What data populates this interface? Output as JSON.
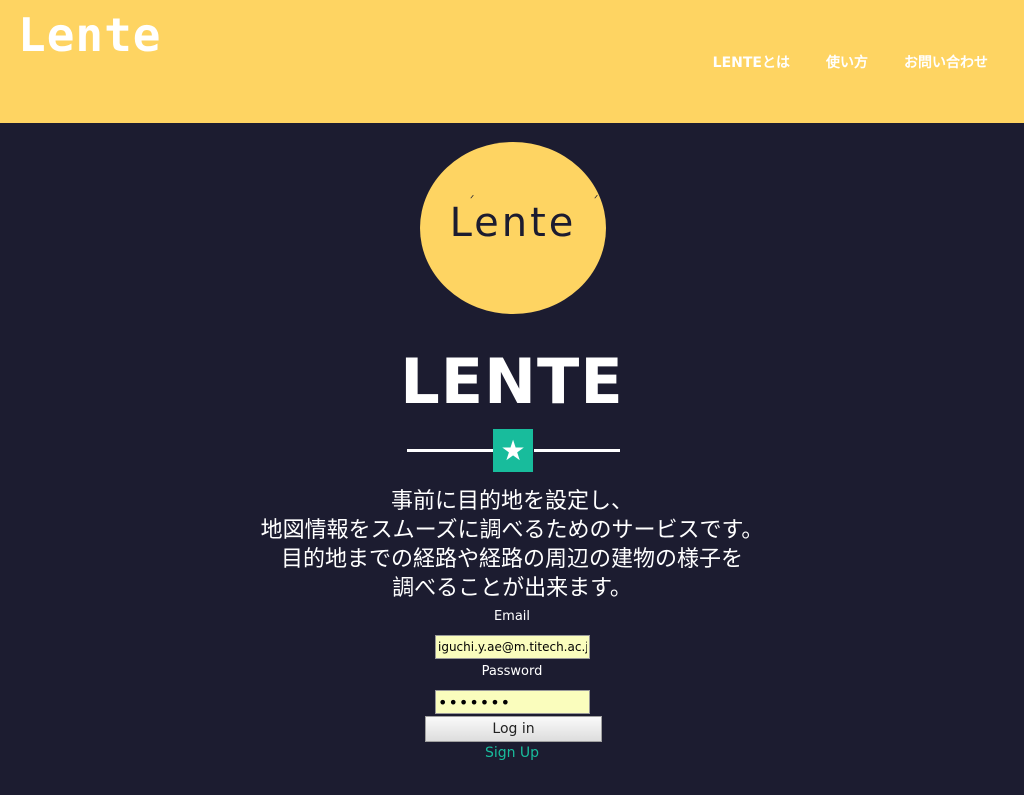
{
  "header": {
    "brand": "Lente",
    "nav": [
      {
        "label": "LENTEとは"
      },
      {
        "label": "使い方"
      },
      {
        "label": "お問い合わせ"
      }
    ]
  },
  "hero": {
    "logo_text": "Lente",
    "title": "LENTE",
    "divider_icon": "star-icon",
    "description": [
      "事前に目的地を設定し、",
      "地図情報をスムーズに調べるためのサービスです。",
      "目的地までの経路や経路の周辺の建物の様子を",
      "調べることが出来ます。"
    ]
  },
  "login_form": {
    "email_label": "Email",
    "email_value": "iguchi.y.ae@m.titech.ac.jp",
    "password_label": "Password",
    "password_value": "•••••••",
    "login_button": "Log in",
    "signup_link": "Sign Up"
  },
  "colors": {
    "header_bg": "#fed462",
    "page_bg": "#1c1c30",
    "accent": "#18bc9c",
    "input_bg": "#fafdbd"
  }
}
